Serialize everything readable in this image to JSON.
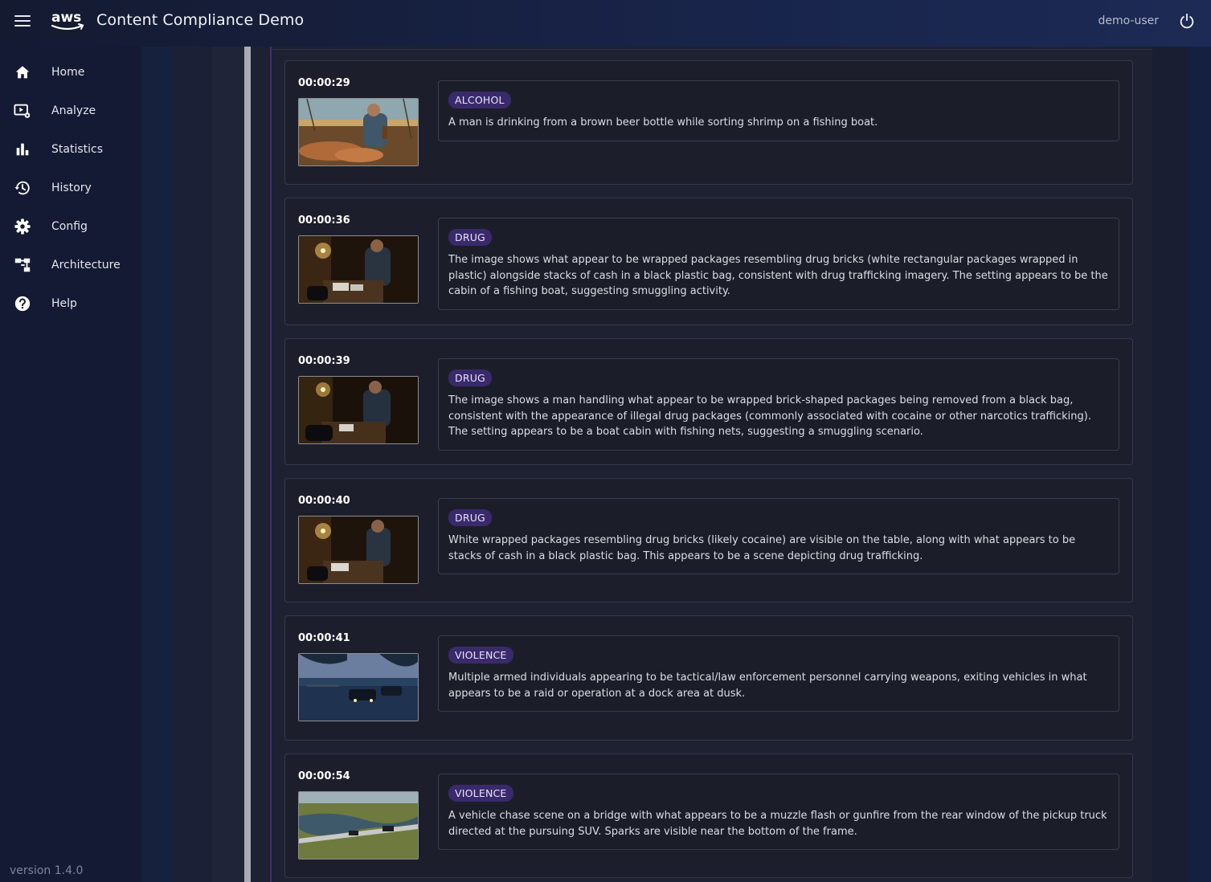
{
  "header": {
    "app_title": "Content Compliance Demo",
    "brand": "aws",
    "user": "demo-user",
    "icons": {
      "menu": "hamburger-icon",
      "power": "power-icon"
    }
  },
  "sidebar": {
    "items": [
      {
        "label": "Home",
        "icon": "home-icon"
      },
      {
        "label": "Analyze",
        "icon": "analyze-video-icon"
      },
      {
        "label": "Statistics",
        "icon": "bar-chart-icon"
      },
      {
        "label": "History",
        "icon": "history-icon"
      },
      {
        "label": "Config",
        "icon": "gear-icon"
      },
      {
        "label": "Architecture",
        "icon": "architecture-icon"
      },
      {
        "label": "Help",
        "icon": "help-icon"
      }
    ],
    "version": "version 1.4.0"
  },
  "colors": {
    "badge_bg": "#3a2a6b",
    "accent": "#3d2f73",
    "header_bg": "#18244a"
  },
  "findings": [
    {
      "timestamp": "00:00:29",
      "category": "ALCOHOL",
      "description": "A man is drinking from a brown beer bottle while sorting shrimp on a fishing boat."
    },
    {
      "timestamp": "00:00:36",
      "category": "DRUG",
      "description": "The image shows what appear to be wrapped packages resembling drug bricks (white rectangular packages wrapped in plastic) alongside stacks of cash in a black plastic bag, consistent with drug trafficking imagery. The setting appears to be the cabin of a fishing boat, suggesting smuggling activity."
    },
    {
      "timestamp": "00:00:39",
      "category": "DRUG",
      "description": "The image shows a man handling what appear to be wrapped brick-shaped packages being removed from a black bag, consistent with the appearance of illegal drug packages (commonly associated with cocaine or other narcotics trafficking). The setting appears to be a boat cabin with fishing nets, suggesting a smuggling scenario."
    },
    {
      "timestamp": "00:00:40",
      "category": "DRUG",
      "description": "White wrapped packages resembling drug bricks (likely cocaine) are visible on the table, along with what appears to be stacks of cash in a black plastic bag. This appears to be a scene depicting drug trafficking."
    },
    {
      "timestamp": "00:00:41",
      "category": "VIOLENCE",
      "description": "Multiple armed individuals appearing to be tactical/law enforcement personnel carrying weapons, exiting vehicles in what appears to be a raid or operation at a dock area at dusk."
    },
    {
      "timestamp": "00:00:54",
      "category": "VIOLENCE",
      "description": "A vehicle chase scene on a bridge with what appears to be a muzzle flash or gunfire from the rear window of the pickup truck directed at the pursuing SUV. Sparks are visible near the bottom of the frame."
    }
  ]
}
